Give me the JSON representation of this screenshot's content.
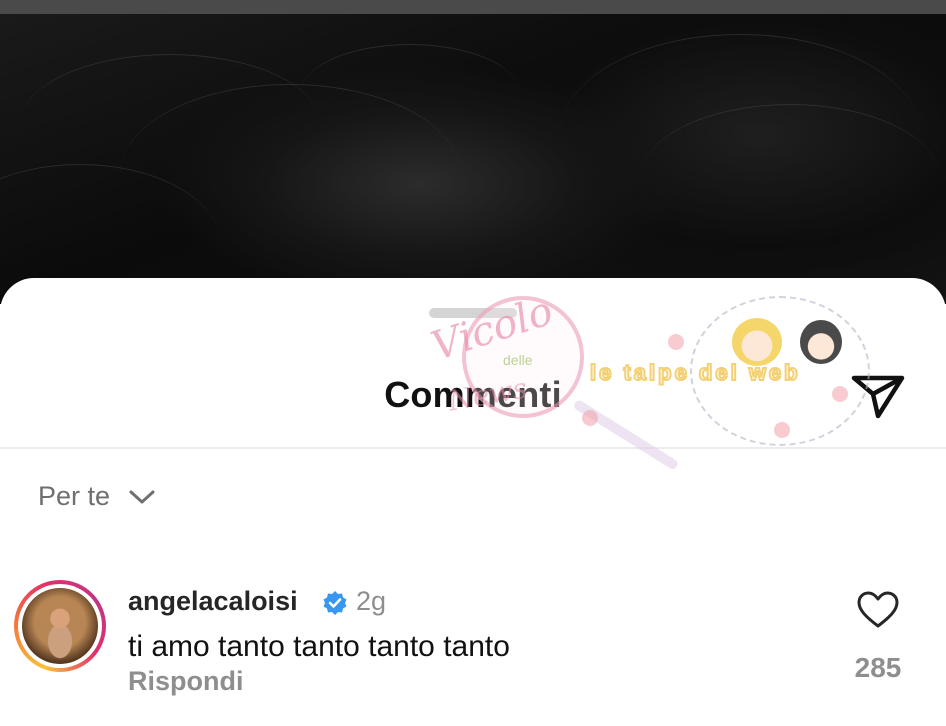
{
  "sheet": {
    "title": "Commenti",
    "filter_label": "Per te"
  },
  "watermarks": {
    "vicolo_line1": "Vicolo",
    "vicolo_line2": "delle",
    "vicolo_line3": "News",
    "talpe": "le talpe del web"
  },
  "comment": {
    "username": "angelacaloisi",
    "verified": true,
    "time": "2g",
    "text": "ti amo tanto tanto tanto tanto",
    "reply_label": "Rispondi",
    "like_count": "285"
  },
  "colors": {
    "verified_blue": "#3897f0",
    "text_primary": "#111111",
    "text_secondary": "#8e8e8e"
  }
}
